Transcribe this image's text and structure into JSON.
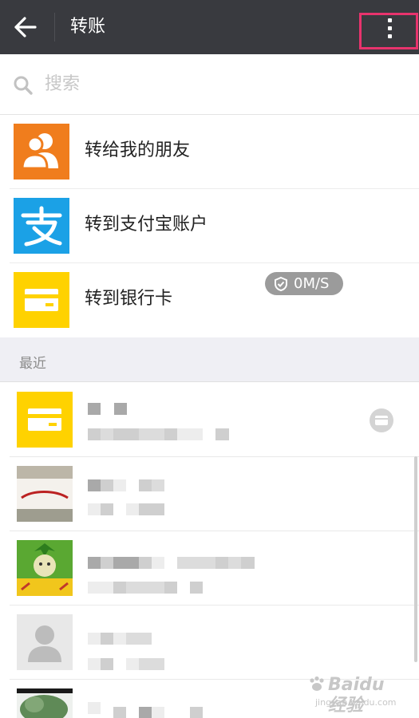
{
  "header": {
    "title": "转账",
    "back_icon": "arrow-left-icon",
    "more_icon": "more-vertical-icon",
    "highlight_color": "#e8336d"
  },
  "search": {
    "placeholder": "搜索",
    "icon": "search-icon"
  },
  "options": [
    {
      "label": "转给我的朋友",
      "icon": "friends-icon",
      "color": "#f07d1d"
    },
    {
      "label": "转到支付宝账户",
      "icon": "alipay-icon",
      "color": "#1ba1e6"
    },
    {
      "label": "转到银行卡",
      "icon": "bank-card-icon",
      "color": "#ffd200"
    }
  ],
  "speed_badge": {
    "text": "0M/S",
    "icon": "shield-check-icon"
  },
  "recent": {
    "header": "最近",
    "contacts": [
      {
        "avatar": "bank-card-icon",
        "action_icon": "card-icon"
      },
      {
        "avatar": "photo-avatar"
      },
      {
        "avatar": "cartoon-avatar"
      },
      {
        "avatar": "default-user-icon"
      },
      {
        "avatar": "tree-photo-avatar"
      }
    ]
  },
  "watermark": {
    "text": "Baidu 经验",
    "sub": "jingyan.baidu.com"
  }
}
